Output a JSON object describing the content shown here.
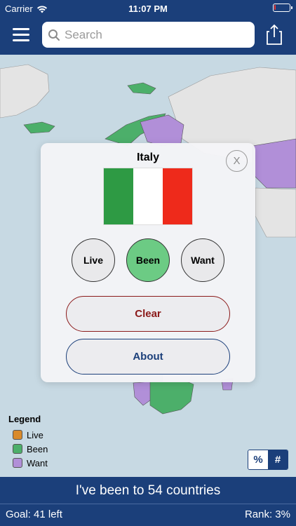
{
  "status_bar": {
    "carrier": "Carrier",
    "time": "11:07 PM",
    "wifi_icon": "wifi-icon",
    "battery_icon": "battery-icon",
    "battery_level": 0.08
  },
  "nav": {
    "menu_icon": "hamburger-icon",
    "search_icon": "search-icon",
    "search_placeholder": "Search",
    "search_value": "",
    "share_icon": "share-icon"
  },
  "modal": {
    "title": "Italy",
    "close_label": "X",
    "flag_colors": [
      "#2e9a44",
      "#ffffff",
      "#ee2a1b"
    ],
    "buttons": {
      "live": "Live",
      "been": "Been",
      "want": "Want"
    },
    "selected": "been",
    "clear_label": "Clear",
    "about_label": "About"
  },
  "legend": {
    "title": "Legend",
    "items": [
      {
        "label": "Live",
        "color": "#d98a2b"
      },
      {
        "label": "Been",
        "color": "#4caf6a"
      },
      {
        "label": "Want",
        "color": "#b18fd8"
      }
    ]
  },
  "toggle": {
    "percent_label": "%",
    "number_label": "#",
    "active": "number"
  },
  "footer": {
    "summary": "I've been to 54 countries",
    "goal": "Goal: 41 left",
    "rank": "Rank: 3%"
  },
  "colors": {
    "nav": "#1b3f7a",
    "ocean": "#c7d9e3",
    "land": "#e4e4e4",
    "been": "#4caf6a",
    "want": "#b18fd8",
    "clear": "#8b1a1a"
  }
}
